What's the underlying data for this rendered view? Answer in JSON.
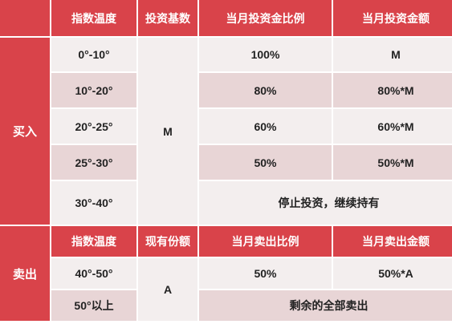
{
  "sections": {
    "buy": {
      "label": "买入",
      "headers": [
        "指数温度",
        "投资基数",
        "当月投资金比例",
        "当月投资金额"
      ],
      "base": "M",
      "rows": [
        {
          "temp": "0°-10°",
          "ratio": "100%",
          "amount": "M"
        },
        {
          "temp": "10°-20°",
          "ratio": "80%",
          "amount": "80%*M"
        },
        {
          "temp": "20°-25°",
          "ratio": "60%",
          "amount": "60%*M"
        },
        {
          "temp": "25°-30°",
          "ratio": "50%",
          "amount": "50%*M"
        },
        {
          "temp": "30°-40°",
          "note": "停止投资，继续持有"
        }
      ]
    },
    "sell": {
      "label": "卖出",
      "headers": [
        "指数温度",
        "现有份额",
        "当月卖出比例",
        "当月卖出金额"
      ],
      "base": "A",
      "rows": [
        {
          "temp": "40°-50°",
          "ratio": "50%",
          "amount": "50%*A"
        },
        {
          "temp": "50°以上",
          "note": "剩余的全部卖出"
        }
      ]
    }
  }
}
